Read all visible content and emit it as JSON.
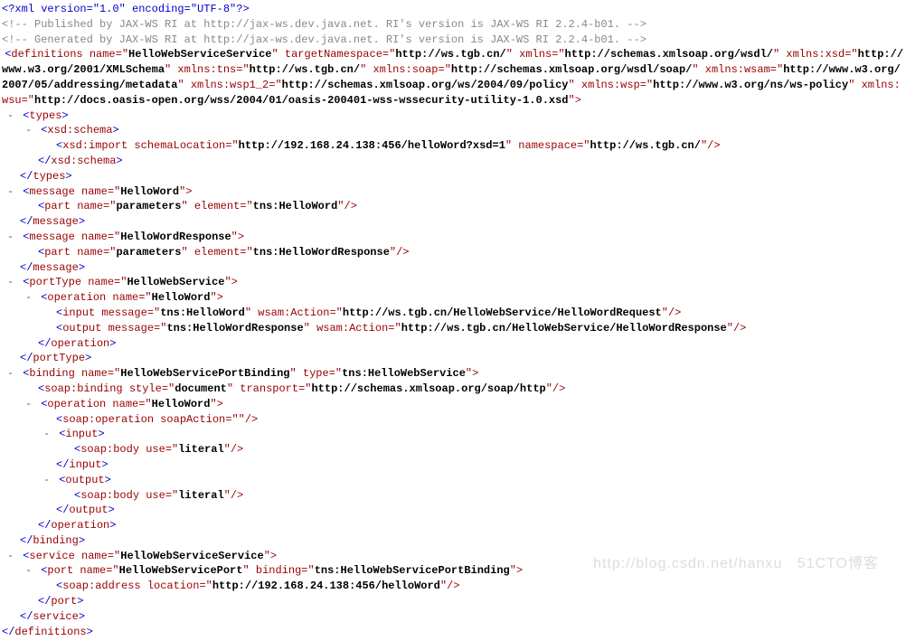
{
  "l1": "<?xml version=\"1.0\" encoding=\"UTF-8\"?>",
  "c1": "<!-- Published by JAX-WS RI at http://jax-ws.dev.java.net. RI's version is JAX-WS RI 2.2.4-b01. -->",
  "c2": "<!-- Generated by JAX-WS RI at http://jax-ws.dev.java.net. RI's version is JAX-WS RI 2.2.4-b01. -->",
  "def": {
    "open": "definitions",
    "name_a": "name=\"",
    "name_v": "HelloWebServiceService",
    "tn_a": "\" targetNamespace=\"",
    "tn_v": "http://ws.tgb.cn/",
    "x_a": "\" xmlns=\"",
    "x_v": "http://schemas.xmlsoap.org/wsdl/",
    "xsd_a": "\" xmlns:xsd=\"",
    "xsd_v": "http://www.w3.org/2001/XMLSchema",
    "tns_a": "\" xmlns:tns=\"",
    "tns_v": "http://ws.tgb.cn/",
    "soap_a": "\" xmlns:soap=\"",
    "soap_v": "http://schemas.xmlsoap.org/wsdl/soap/",
    "wsam_a": "\" xmlns:wsam=\"",
    "wsam_v": "http://www.w3.org/2007/05/addressing/metadata",
    "wsp12_a": "\" xmlns:wsp1_2=\"",
    "wsp12_v": "http://schemas.xmlsoap.org/ws/2004/09/policy",
    "wsp_a": "\" xmlns:wsp=\"",
    "wsp_v": "http://www.w3.org/ns/ws-policy",
    "wsu_a": "\" xmlns:wsu=\"",
    "wsu_v": "http://docs.oasis-open.org/wss/2004/01/oasis-200401-wss-wssecurity-utility-1.0.xsd",
    "end": "\">"
  },
  "types_open": "types",
  "types_close": "types",
  "xsdschema_open": "xsd:schema",
  "xsdschema_close": "xsd:schema",
  "xsdimport": {
    "tag": "xsd:import",
    "sl_a": "schemaLocation=\"",
    "sl_v": "http://192.168.24.138:456/helloWord?xsd=1",
    "ns_a": "\" namespace=\"",
    "ns_v": "http://ws.tgb.cn/",
    "end": "\"/>"
  },
  "msg1": {
    "tag": "message",
    "na": "name=\"",
    "nv": "HelloWord",
    "close": "\">"
  },
  "part1": {
    "tag": "part",
    "na": "name=\"",
    "nv": "parameters",
    "ea": "\" element=\"",
    "ev": "tns:HelloWord",
    "end": "\"/>"
  },
  "msg1c": "message",
  "msg2": {
    "tag": "message",
    "na": "name=\"",
    "nv": "HelloWordResponse",
    "close": "\">"
  },
  "part2": {
    "tag": "part",
    "na": "name=\"",
    "nv": "parameters",
    "ea": "\" element=\"",
    "ev": "tns:HelloWordResponse",
    "end": "\"/>"
  },
  "msg2c": "message",
  "pt": {
    "tag": "portType",
    "na": "name=\"",
    "nv": "HelloWebService",
    "close": "\">",
    "op_tag": "operation",
    "op_na": "name=\"",
    "op_nv": "HelloWord",
    "op_close": "\">",
    "in_tag": "input",
    "in_ma": "message=\"",
    "in_mv": "tns:HelloWord",
    "in_wa": "\" wsam:Action=\"",
    "in_wv": "http://ws.tgb.cn/HelloWebService/HelloWordRequest",
    "in_end": "\"/>",
    "out_tag": "output",
    "out_ma": "message=\"",
    "out_mv": "tns:HelloWordResponse",
    "out_wa": "\" wsam:Action=\"",
    "out_wv": "http://ws.tgb.cn/HelloWebService/HelloWordResponse",
    "out_end": "\"/>",
    "op_c": "operation",
    "pt_c": "portType"
  },
  "bind": {
    "tag": "binding",
    "na": "name=\"",
    "nv": "HelloWebServicePortBinding",
    "ta": "\" type=\"",
    "tv": "tns:HelloWebService",
    "close": "\">",
    "sb_tag": "soap:binding",
    "sb_sa": "style=\"",
    "sb_sv": "document",
    "sb_ta": "\" transport=\"",
    "sb_tv": "http://schemas.xmlsoap.org/soap/http",
    "sb_end": "\"/>",
    "op_tag": "operation",
    "op_na": "name=\"",
    "op_nv": "HelloWord",
    "op_close": "\">",
    "so_tag": "soap:operation",
    "so_a": "soapAction=\"",
    "so_v": "",
    "so_end": "\"/>",
    "in_open": "input",
    "body_tag": "soap:body",
    "body_a": "use=\"",
    "body_v": "literal",
    "body_end": "\"/>",
    "in_close": "input",
    "out_open": "output",
    "out_close": "output",
    "op_c": "operation",
    "bind_c": "binding"
  },
  "svc": {
    "tag": "service",
    "na": "name=\"",
    "nv": "HelloWebServiceService",
    "close": "\">",
    "port_tag": "port",
    "port_na": "name=\"",
    "port_nv": "HelloWebServicePort",
    "port_ba": "\" binding=\"",
    "port_bv": "tns:HelloWebServicePortBinding",
    "port_close": "\">",
    "addr_tag": "soap:address",
    "addr_a": "location=\"",
    "addr_v": "http://192.168.24.138:456/helloWord",
    "addr_end": "\"/>",
    "port_c": "port",
    "svc_c": "service"
  },
  "def_close": "definitions",
  "watermark1": "http://blog.csdn.net/hanxu",
  "watermark2": "51CTO博客"
}
